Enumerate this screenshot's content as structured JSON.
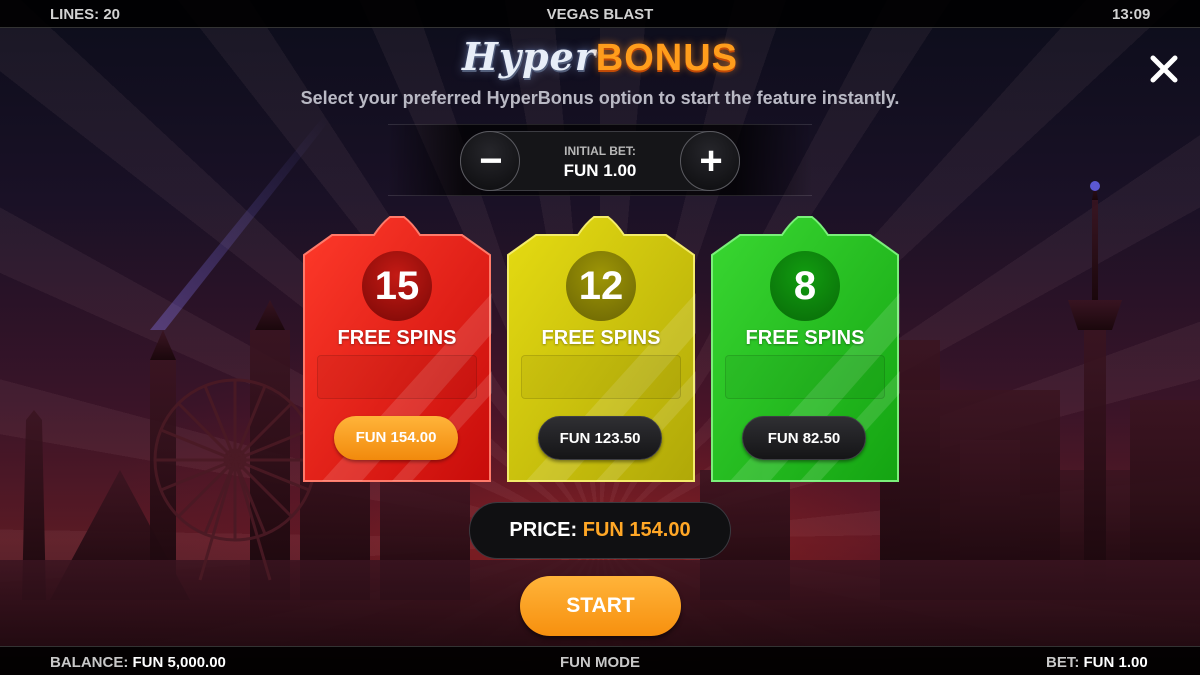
{
  "top_bar": {
    "lines_label": "LINES: 20",
    "game_title": "VEGAS BLAST",
    "clock": "13:09"
  },
  "header": {
    "logo_hyper": "Hyper",
    "logo_bonus": "BONUS",
    "subtitle": "Select your preferred HyperBonus option to start the feature instantly."
  },
  "close_icon": "close-icon",
  "bet": {
    "label": "INITIAL BET:",
    "value": "FUN 1.00",
    "decrease_glyph": "−",
    "increase_glyph": "+"
  },
  "options": [
    {
      "spins": "15",
      "label": "FREE SPINS",
      "price": "FUN 154.00",
      "selected": true,
      "color": "#e21a12"
    },
    {
      "spins": "12",
      "label": "FREE SPINS",
      "price": "FUN 123.50",
      "selected": false,
      "color": "#c9c00a"
    },
    {
      "spins": "8",
      "label": "FREE SPINS",
      "price": "FUN 82.50",
      "selected": false,
      "color": "#1fc21a"
    }
  ],
  "price": {
    "label": "PRICE:",
    "value": "FUN 154.00"
  },
  "start_label": "START",
  "bottom_bar": {
    "balance_label": "BALANCE:",
    "balance_value": "FUN 5,000.00",
    "mode": "FUN MODE",
    "bet_label": "BET:",
    "bet_value": "FUN 1.00"
  },
  "colors": {
    "accent_orange": "#ffa726",
    "card_red": "#e21a12",
    "card_yellow": "#c9c00a",
    "card_green": "#1fc21a"
  }
}
